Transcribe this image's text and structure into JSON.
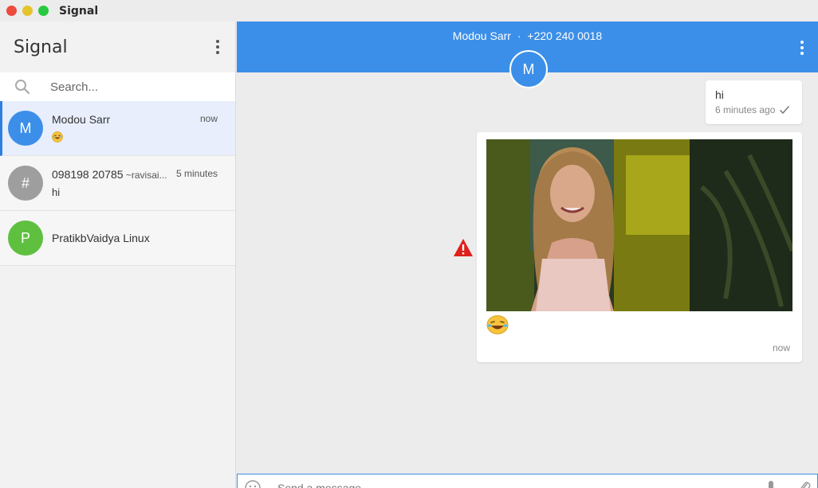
{
  "window": {
    "title": "Signal"
  },
  "sidebar": {
    "title": "Signal",
    "search": {
      "placeholder": "Search..."
    },
    "conversations": [
      {
        "initial": "M",
        "name": "Modou Sarr",
        "name_suffix": "",
        "time": "now",
        "snippet": "😂",
        "color": "#3c8fe8",
        "active": true
      },
      {
        "initial": "#",
        "name": "098198 20785",
        "name_suffix": " ~ravisai...",
        "time": "5 minutes",
        "snippet": "hi",
        "color": "#9e9e9e",
        "active": false
      },
      {
        "initial": "P",
        "name": "PratikbVaidya Linux",
        "name_suffix": "",
        "time": "",
        "snippet": "",
        "color": "#5fc03f",
        "active": false
      }
    ]
  },
  "chat": {
    "contact_name": "Modou Sarr",
    "separator": "·",
    "contact_phone": "+220 240 0018",
    "contact_initial": "M",
    "header_color": "#3c8fe8",
    "messages": [
      {
        "text": "hi",
        "time": "6 minutes ago",
        "status": "check-icon"
      },
      {
        "media": "gif-woman-smiling",
        "caption": "😂",
        "time": "now",
        "status": "warning-icon"
      }
    ],
    "composer": {
      "placeholder": "Send a message"
    }
  }
}
